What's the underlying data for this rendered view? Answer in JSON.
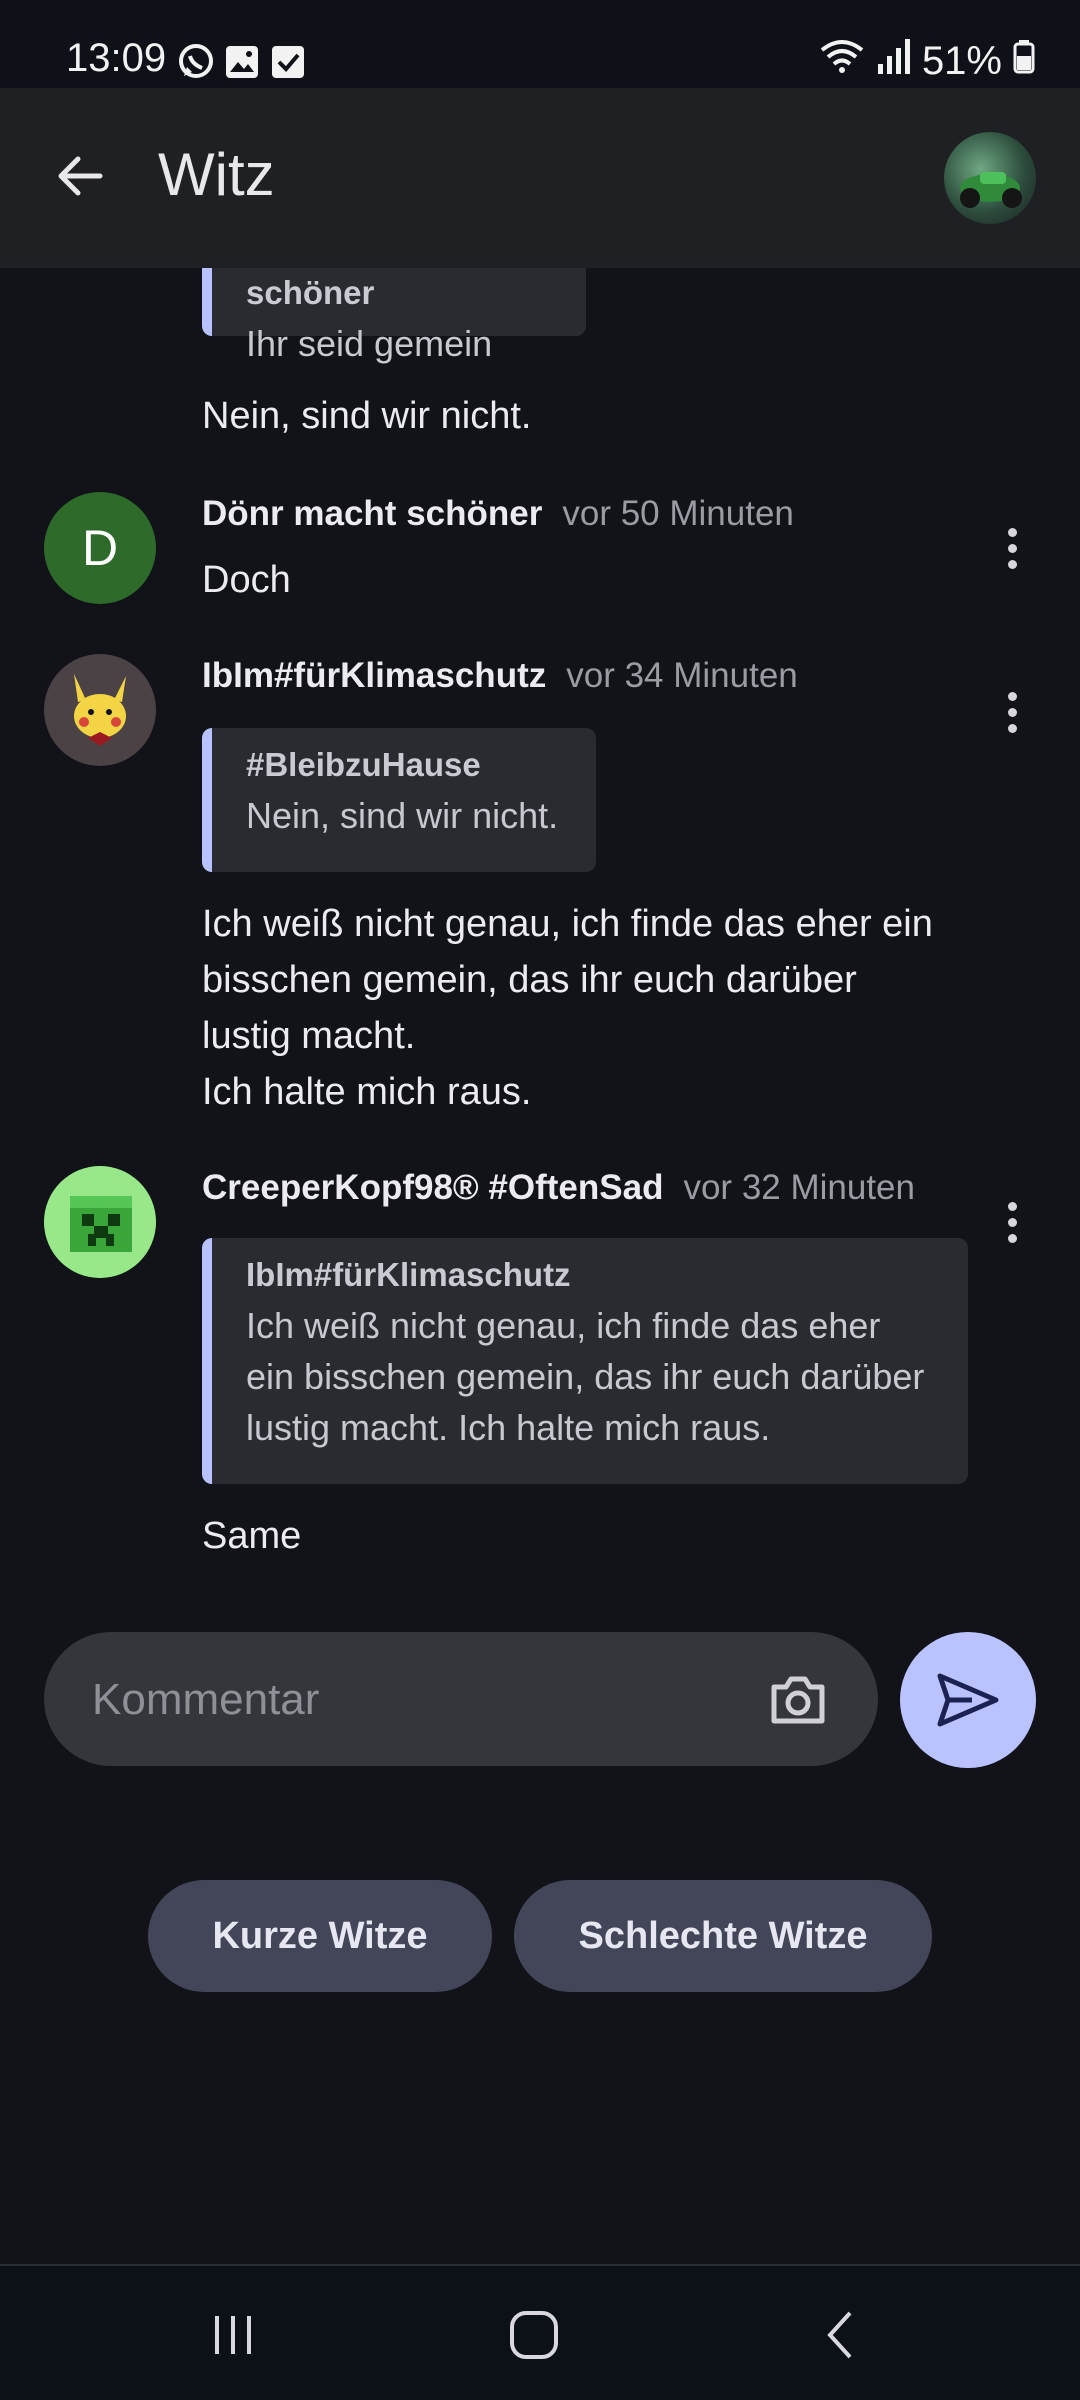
{
  "status_bar": {
    "time": "13:09",
    "battery": "51%",
    "icons": [
      "whatsapp-icon",
      "gallery-icon",
      "checkbox-icon",
      "wifi-icon",
      "signal-icon",
      "battery-icon"
    ]
  },
  "header": {
    "title": "Witz",
    "back_icon": "arrow-back-icon"
  },
  "feed": {
    "top_quote": {
      "author": "Dönr macht schöner",
      "text": "Ihr seid gemein"
    },
    "top_reply": "Nein, sind wir nicht.",
    "comments": [
      {
        "avatar_letter": "D",
        "avatar_color": "#2e6a2a",
        "author": "Dönr macht schöner",
        "time": "vor 50 Minuten",
        "text": "Doch"
      },
      {
        "author": "IbIm#fürKlimaschutz",
        "time": "vor 34 Minuten",
        "quote": {
          "author": "#BleibzuHause",
          "text": "Nein, sind wir nicht."
        },
        "text_lines": [
          "Ich weiß nicht genau, ich finde das eher ein",
          "bisschen gemein, das ihr euch darüber",
          "lustig macht.",
          "Ich halte mich raus."
        ]
      },
      {
        "author": "CreeperKopf98® #OftenSad",
        "time": "vor 32 Minuten",
        "quote": {
          "author": "IbIm#fürKlimaschutz",
          "text_lines": [
            "Ich weiß nicht genau, ich finde das eher",
            "ein bisschen gemein, das ihr euch darüber",
            "lustig macht. Ich halte mich raus."
          ]
        },
        "text": "Same"
      }
    ]
  },
  "composer": {
    "placeholder": "Kommentar",
    "camera_icon": "camera-icon",
    "send_icon": "send-icon"
  },
  "chips": [
    "Kurze Witze",
    "Schlechte Witze"
  ],
  "colors": {
    "background": "#111318",
    "accent": "#bac3ff",
    "quote_bar": "#b8c2ff",
    "chip": "#434659"
  }
}
